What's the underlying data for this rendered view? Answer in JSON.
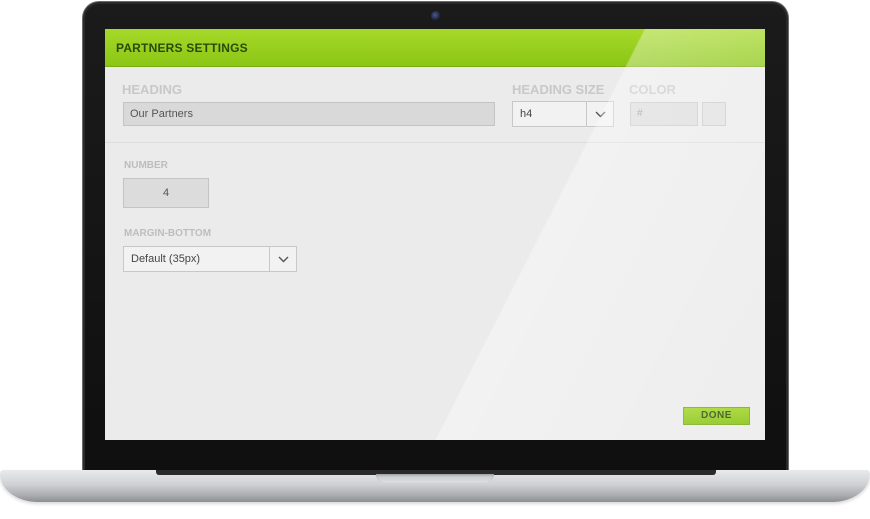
{
  "modal": {
    "title": "PARTNERS SETTINGS",
    "heading": {
      "label": "HEADING",
      "value": "Our Partners"
    },
    "heading_size": {
      "label": "HEADING SIZE",
      "value": "h4"
    },
    "color": {
      "label": "COLOR",
      "placeholder": "#"
    },
    "number": {
      "label": "NUMBER",
      "value": "4"
    },
    "margin_bottom": {
      "label": "MARGIN-BOTTOM",
      "value": "Default (35px)"
    },
    "done_label": "DONE"
  },
  "colors": {
    "accent": "#8cc614",
    "accent_text": "#2b4a08",
    "panel_bg": "#ebebeb"
  },
  "icons": {
    "select_arrow": "chevron-down-icon",
    "camera": "camera-icon"
  }
}
